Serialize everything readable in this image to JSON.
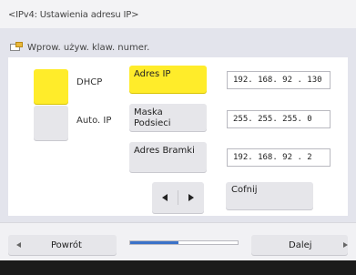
{
  "screen": {
    "title": "<IPv4: Ustawienia adresu IP>"
  },
  "hint": {
    "text": "Wprow. używ. klaw. numer.",
    "icon": "keyboard-icon"
  },
  "options": {
    "dhcp": {
      "label": "DHCP",
      "checked": true
    },
    "auto_ip": {
      "label": "Auto. IP",
      "checked": false
    }
  },
  "fields": {
    "ip": {
      "label": "Adres IP",
      "value": "192. 168. 92 . 130",
      "selected": true
    },
    "subnet": {
      "label": "Maska Podsieci",
      "value": "255. 255. 255. 0",
      "selected": false
    },
    "gateway": {
      "label": "Adres Bramki",
      "value": "192. 168. 92 . 2",
      "selected": false
    }
  },
  "cursor": {
    "left_icon": "arrow-left-icon",
    "right_icon": "arrow-right-icon"
  },
  "actions": {
    "undo_label": "Cofnij"
  },
  "nav": {
    "back_label": "Powrót",
    "next_label": "Dalej",
    "progress": 0.45
  },
  "colors": {
    "selected": "#ffec2a",
    "progress": "#3b72c9"
  }
}
